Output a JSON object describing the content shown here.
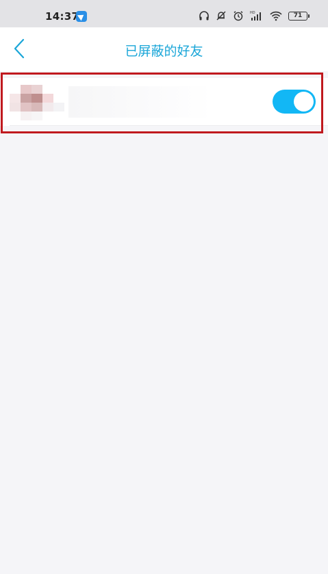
{
  "status_bar": {
    "time": "14:37",
    "app_icon": "paper-plane-icon",
    "icons": [
      "headset-icon",
      "notification-off-icon",
      "alarm-icon",
      "hd-signal-icon",
      "wifi-icon"
    ],
    "battery_level": "71"
  },
  "nav": {
    "back_icon": "chevron-left-icon",
    "title": "已屏蔽的好友"
  },
  "blocked_list": {
    "items": [
      {
        "avatar": "pixelated-avatar",
        "name": "",
        "blocked": true
      }
    ]
  },
  "colors": {
    "accent": "#12b7f5",
    "title": "#1aa6d8",
    "highlight": "#c0191e",
    "background": "#f5f5f8"
  }
}
